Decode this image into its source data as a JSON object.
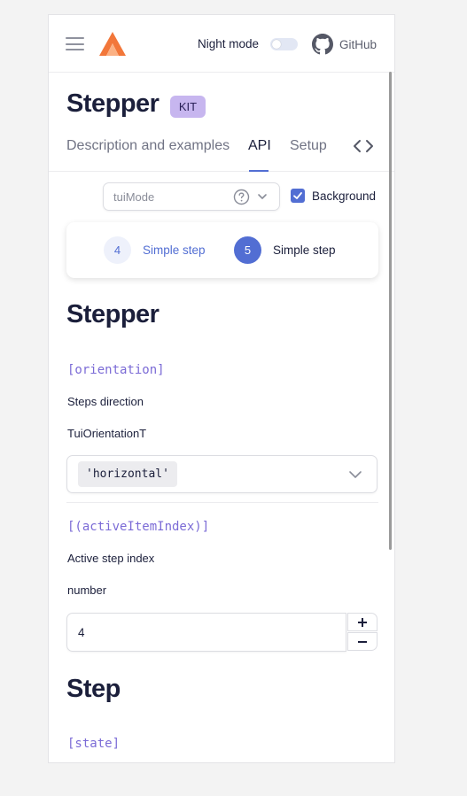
{
  "header": {
    "night_mode_label": "Night mode",
    "github_label": "GitHub",
    "night_mode_on": false
  },
  "page": {
    "title": "Stepper",
    "badge": "KIT",
    "tabs": [
      {
        "label": "Description and examples",
        "active": false
      },
      {
        "label": "API",
        "active": true
      },
      {
        "label": "Setup",
        "active": false
      }
    ]
  },
  "controls": {
    "mode_select_value": "tuiMode",
    "background_label": "Background",
    "background_checked": true
  },
  "preview": {
    "steps": [
      {
        "number": "4",
        "label": "Simple step",
        "active": false
      },
      {
        "number": "5",
        "label": "Simple step",
        "active": true
      }
    ]
  },
  "api": {
    "stepper_heading": "Stepper",
    "orientation": {
      "name": "[orientation]",
      "description": "Steps direction",
      "type": "TuiOrientationT",
      "value": "'horizontal'"
    },
    "active_index": {
      "name": "[(activeItemIndex)]",
      "description": "Active step index",
      "type": "number",
      "value": "4",
      "plus": "+",
      "minus": "−"
    },
    "step_heading": "Step",
    "state": {
      "name": "[state]"
    }
  },
  "colors": {
    "accent": "#526ed3",
    "badge_bg": "#c7b6ef",
    "mono_text": "#7b6bd6",
    "logo": "#f2773a"
  },
  "icons": [
    "menu-icon",
    "taiga-logo-icon",
    "github-icon",
    "code-icon",
    "help-icon",
    "chevron-down-icon",
    "checkmark-icon"
  ]
}
